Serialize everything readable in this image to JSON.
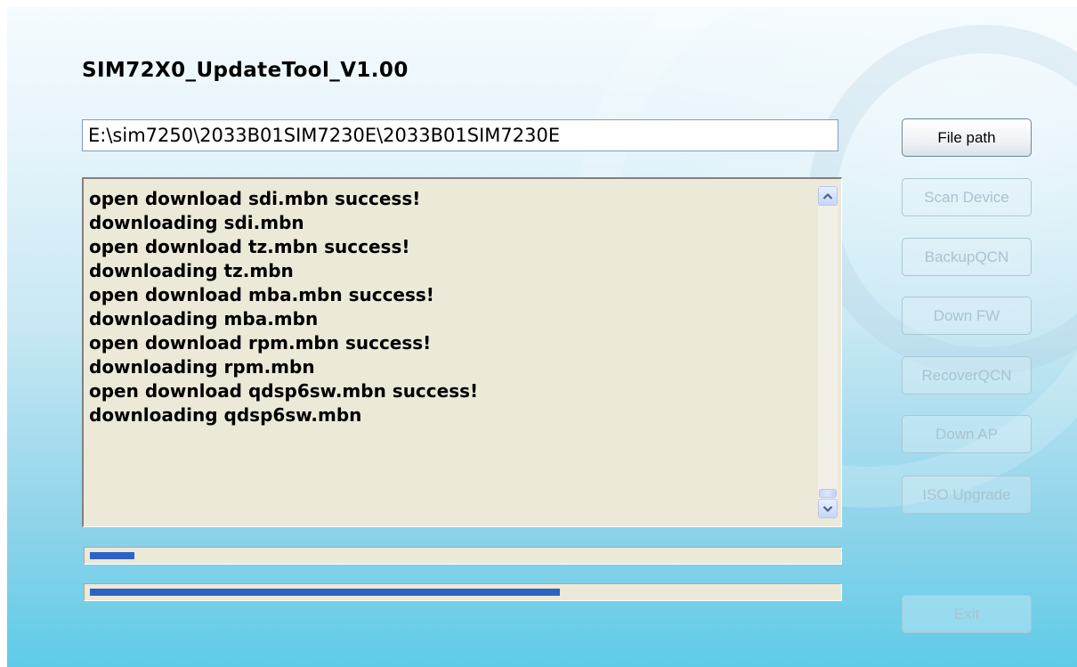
{
  "app": {
    "title": "SIM72X0_UpdateTool_V1.00"
  },
  "path_input": {
    "value": "E:\\sim7250\\2033B01SIM7230E\\2033B01SIM7230E"
  },
  "log": {
    "lines": [
      "open download sdi.mbn success!",
      "downloading sdi.mbn",
      "open download tz.mbn success!",
      "downloading tz.mbn",
      "open download mba.mbn success!",
      "downloading mba.mbn",
      "open download rpm.mbn success!",
      "downloading rpm.mbn",
      "open download qdsp6sw.mbn success!",
      "downloading qdsp6sw.mbn"
    ]
  },
  "progress": {
    "file_fraction": 0.06,
    "total_fraction": 0.63,
    "fill_color": "#2c63c5"
  },
  "buttons": {
    "file_path": "File path",
    "scan_device": "Scan Device",
    "backup_qcn": "BackupQCN",
    "down_fw": "Down FW",
    "recover_qcn": "RecoverQCN",
    "down_ap": "Down AP",
    "iso_upgrade": "ISO Upgrade",
    "exit": "Exit"
  },
  "icons": {
    "scroll_up": "chevron-up-icon",
    "scroll_down": "chevron-down-icon"
  },
  "colors": {
    "accent": "#2c63c5",
    "log_background": "#ece9d8",
    "disabled_text": "#a8c4cf"
  }
}
